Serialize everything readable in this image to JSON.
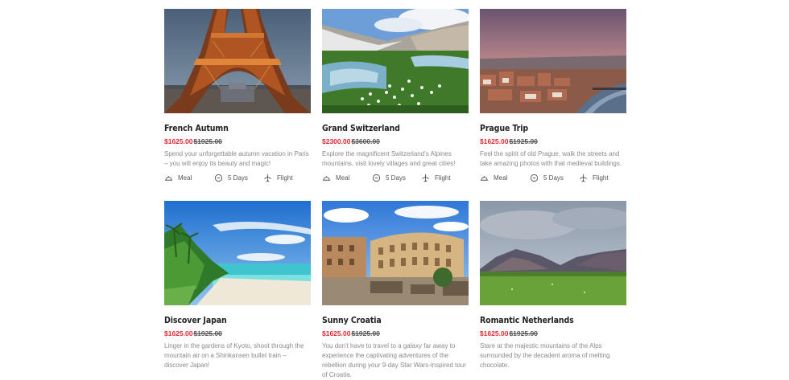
{
  "tours": [
    {
      "title": "French Autumn",
      "price_now": "$1625.00",
      "price_old": "$1925.00",
      "description": "Spend your unforgettable autumn vacation in Paris – you will enjoy its beauty and magic!",
      "features": [
        "Meal",
        "5 Days",
        "Flight"
      ]
    },
    {
      "title": "Grand Switzerland",
      "price_now": "$2300.00",
      "price_old": "$3600.00",
      "description": "Explore the magnificent Switzerland's Alpines mountains, visit lovely villages and great cities!",
      "features": [
        "Meal",
        "5 Days",
        "Flight"
      ]
    },
    {
      "title": "Prague Trip",
      "price_now": "$1625.00",
      "price_old": "$1925.00",
      "description": "Feel the spirit of old Prague, walk the streets and take amazing photos with that medieval buildings.",
      "features": [
        "Meal",
        "5 Days",
        "Flight"
      ]
    },
    {
      "title": "Discover Japan",
      "price_now": "$1625.00",
      "price_old": "$1925.00",
      "description": "Linger in the gardens of Kyoto, shoot through the mountain air on a Shinkansen bullet train – discover Japan!",
      "features": []
    },
    {
      "title": "Sunny Croatia",
      "price_now": "$1625.00",
      "price_old": "$1925.00",
      "description": "You don't have to travel to a galaxy far away to experience the captivating adventures of the rebellion during your 9-day Star Wars-inspired tour of Croatia.",
      "features": []
    },
    {
      "title": "Romantic Netherlands",
      "price_now": "$1625.00",
      "price_old": "$1925.00",
      "description": "Stare at the majestic mountains of the Alps surrounded by the decadent aroma of melting chocolate.",
      "features": []
    }
  ],
  "icons": {
    "meal": "meal-cloche-icon",
    "days": "clock-icon",
    "flight": "airplane-icon"
  },
  "colors": {
    "price_now": "#e0262e",
    "title": "#222222",
    "description": "#8a8a8a"
  }
}
